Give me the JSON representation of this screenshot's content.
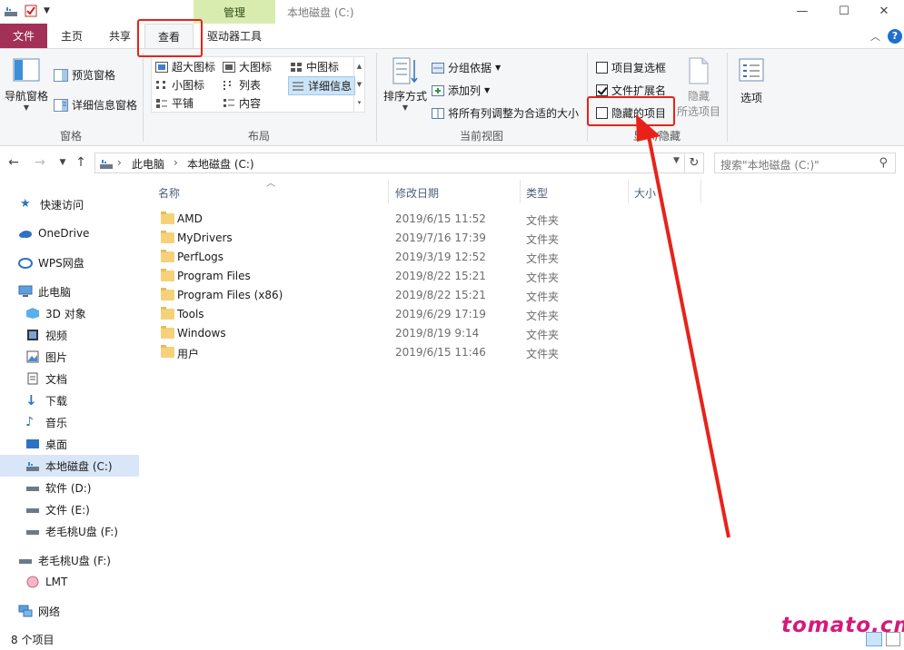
{
  "window": {
    "title": "本地磁盘 (C:)",
    "context_tab": "管理",
    "minimize": "—",
    "maximize": "☐",
    "close": "✕"
  },
  "tabs": {
    "file": "文件",
    "home": "主页",
    "share": "共享",
    "view": "查看",
    "drive_tools": "驱动器工具"
  },
  "ribbon": {
    "panes": {
      "label": "窗格",
      "nav_pane": "导航窗格",
      "preview_pane": "预览窗格",
      "details_pane": "详细信息窗格"
    },
    "layout": {
      "label": "布局",
      "extra_large": "超大图标",
      "large": "大图标",
      "medium": "中图标",
      "small": "小图标",
      "list": "列表",
      "details": "详细信息",
      "tiles": "平铺",
      "content": "内容"
    },
    "current_view": {
      "label": "当前视图",
      "sort_by": "排序方式",
      "group_by": "分组依据",
      "add_column": "添加列",
      "fit_columns": "将所有列调整为合适的大小"
    },
    "show_hide": {
      "label": "显示/隐藏",
      "item_checkboxes": "项目复选框",
      "file_extensions": "文件扩展名",
      "hidden_items": "隐藏的项目",
      "hide_selected": "隐藏",
      "hide_selected_2": "所选项目",
      "item_checkboxes_checked": false,
      "file_extensions_checked": true,
      "hidden_items_checked": false
    },
    "options": "选项"
  },
  "address": {
    "crumbs": [
      "此电脑",
      "本地磁盘 (C:)"
    ],
    "search_placeholder": "搜索\"本地磁盘 (C:)\""
  },
  "nav": {
    "quick_access": "快速访问",
    "onedrive": "OneDrive",
    "wps": "WPS网盘",
    "this_pc": "此电脑",
    "objects3d": "3D 对象",
    "videos": "视频",
    "pictures": "图片",
    "documents": "文档",
    "downloads": "下载",
    "music": "音乐",
    "desktop": "桌面",
    "local_c": "本地磁盘 (C:)",
    "soft_d": "软件 (D:)",
    "file_e": "文件 (E:)",
    "usb_f": "老毛桃U盘 (F:)",
    "usb_f2": "老毛桃U盘 (F:)",
    "lmt": "LMT",
    "network": "网络"
  },
  "columns": {
    "name": "名称",
    "date": "修改日期",
    "type": "类型",
    "size": "大小"
  },
  "files": [
    {
      "name": "AMD",
      "date": "2019/6/15 11:52",
      "type": "文件夹"
    },
    {
      "name": "MyDrivers",
      "date": "2019/7/16 17:39",
      "type": "文件夹"
    },
    {
      "name": "PerfLogs",
      "date": "2019/3/19 12:52",
      "type": "文件夹"
    },
    {
      "name": "Program Files",
      "date": "2019/8/22 15:21",
      "type": "文件夹"
    },
    {
      "name": "Program Files (x86)",
      "date": "2019/8/22 15:21",
      "type": "文件夹"
    },
    {
      "name": "Tools",
      "date": "2019/6/29 17:19",
      "type": "文件夹"
    },
    {
      "name": "Windows",
      "date": "2019/8/19 9:14",
      "type": "文件夹"
    },
    {
      "name": "用户",
      "date": "2019/6/15 11:46",
      "type": "文件夹"
    }
  ],
  "status": {
    "item_count": "8 个项目"
  },
  "watermark": "tomato.cm",
  "colors": {
    "file_tab": "#a33056",
    "manage_tab": "#d9ecb0",
    "annotation": "#e8221a",
    "watermark": "#d6197a"
  }
}
